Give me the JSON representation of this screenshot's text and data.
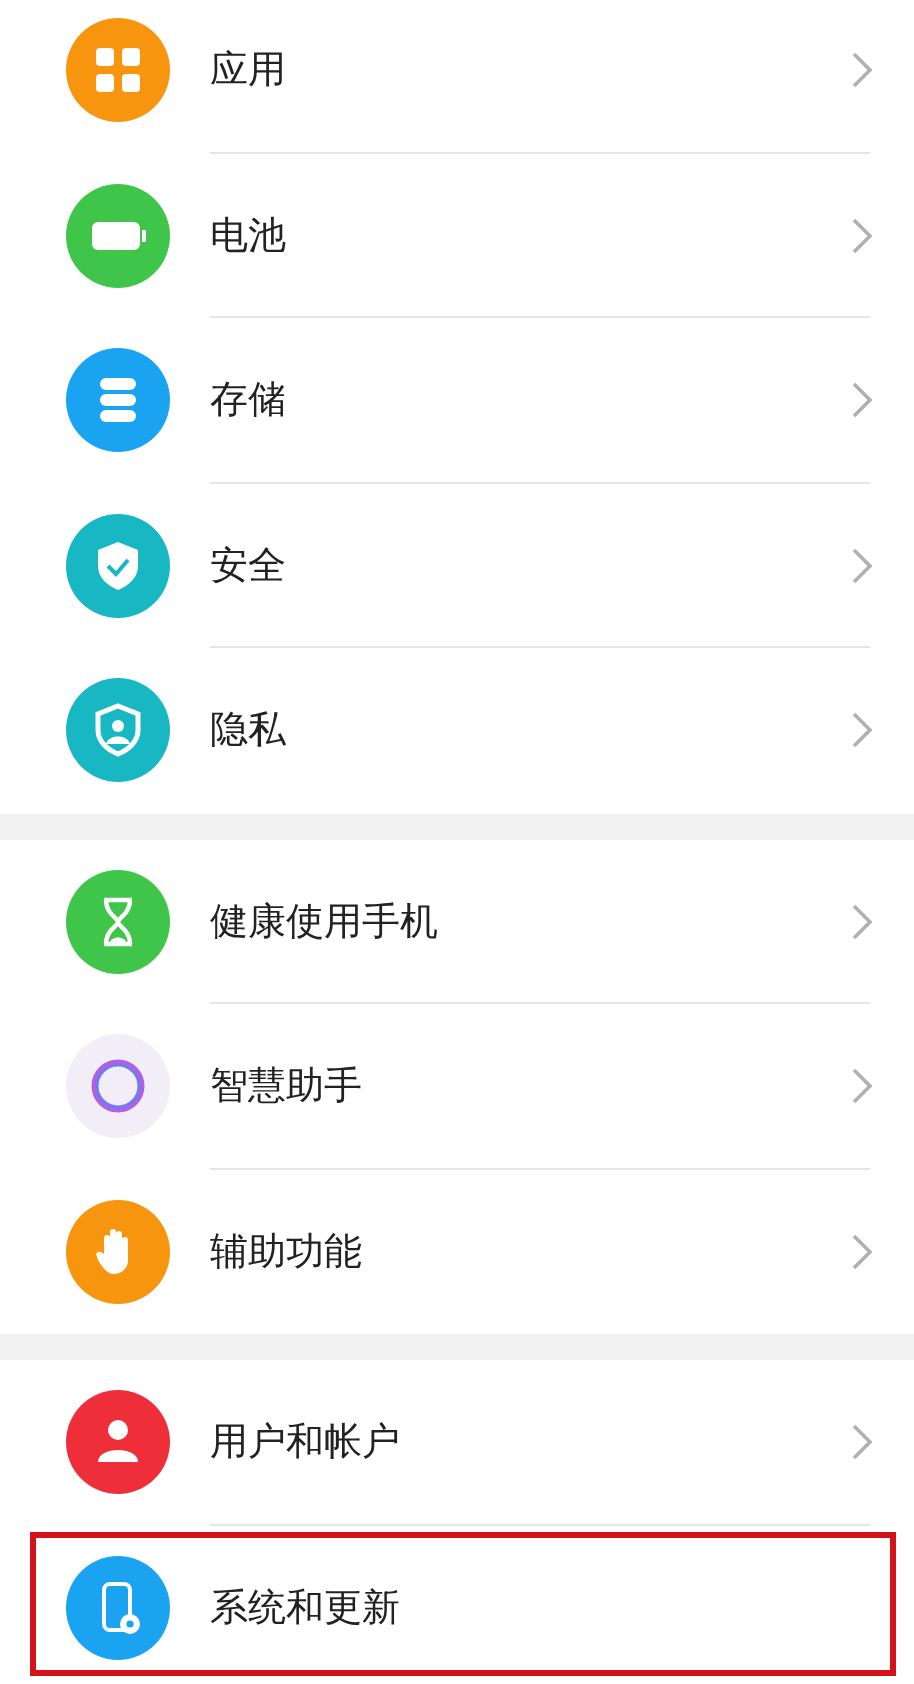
{
  "groups": [
    {
      "items": [
        {
          "kind": "apps",
          "color": "#f7950f",
          "label": "应用",
          "chevron": true,
          "highlighted": false
        },
        {
          "kind": "battery",
          "color": "#3ec54a",
          "label": "电池",
          "chevron": true,
          "highlighted": false
        },
        {
          "kind": "storage",
          "color": "#1aa3f0",
          "label": "存储",
          "chevron": true,
          "highlighted": false
        },
        {
          "kind": "security",
          "color": "#17b8c4",
          "label": "安全",
          "chevron": true,
          "highlighted": false
        },
        {
          "kind": "privacy",
          "color": "#17b8c4",
          "label": "隐私",
          "chevron": true,
          "highlighted": false
        }
      ]
    },
    {
      "items": [
        {
          "kind": "hourglass",
          "color": "#3ec54a",
          "label": "健康使用手机",
          "chevron": true,
          "highlighted": false
        },
        {
          "kind": "assistant",
          "color": "#f2eef8",
          "label": "智慧助手",
          "chevron": true,
          "highlighted": false
        },
        {
          "kind": "hand",
          "color": "#f7950f",
          "label": "辅助功能",
          "chevron": true,
          "highlighted": false
        }
      ]
    },
    {
      "items": [
        {
          "kind": "user",
          "color": "#ee2f3a",
          "label": "用户和帐户",
          "chevron": true,
          "highlighted": false
        },
        {
          "kind": "phone-gear",
          "color": "#1aa3f0",
          "label": "系统和更新",
          "chevron": false,
          "highlighted": true
        }
      ]
    }
  ]
}
